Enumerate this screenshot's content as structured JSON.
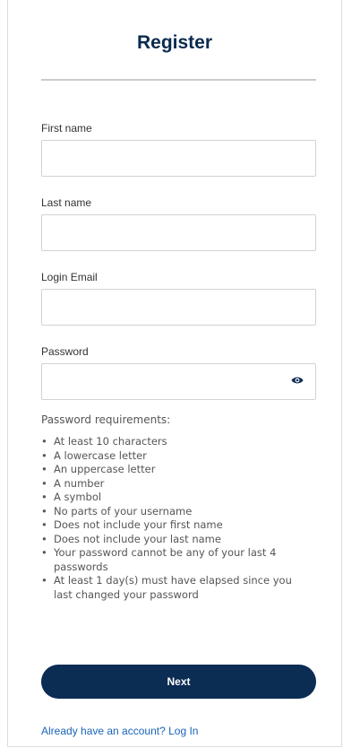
{
  "header": {
    "title": "Register"
  },
  "form": {
    "first_name": {
      "label": "First name",
      "value": ""
    },
    "last_name": {
      "label": "Last name",
      "value": ""
    },
    "login_email": {
      "label": "Login Email",
      "value": ""
    },
    "password": {
      "label": "Password",
      "value": "",
      "toggle_icon": "eye-icon"
    }
  },
  "requirements": {
    "title": "Password requirements:",
    "items": [
      "At least 10 characters",
      "A lowercase letter",
      "An uppercase letter",
      "A number",
      "A symbol",
      "No parts of your username",
      "Does not include your first name",
      "Does not include your last name",
      "Your password cannot be any of your last 4 passwords",
      "At least 1 day(s) must have elapsed since you last changed your password"
    ]
  },
  "actions": {
    "next_label": "Next",
    "login_prompt": "Already have an account? Log In"
  },
  "colors": {
    "primary": "#0b2c53",
    "title": "#0a2a4e",
    "link": "#1a63b8"
  }
}
